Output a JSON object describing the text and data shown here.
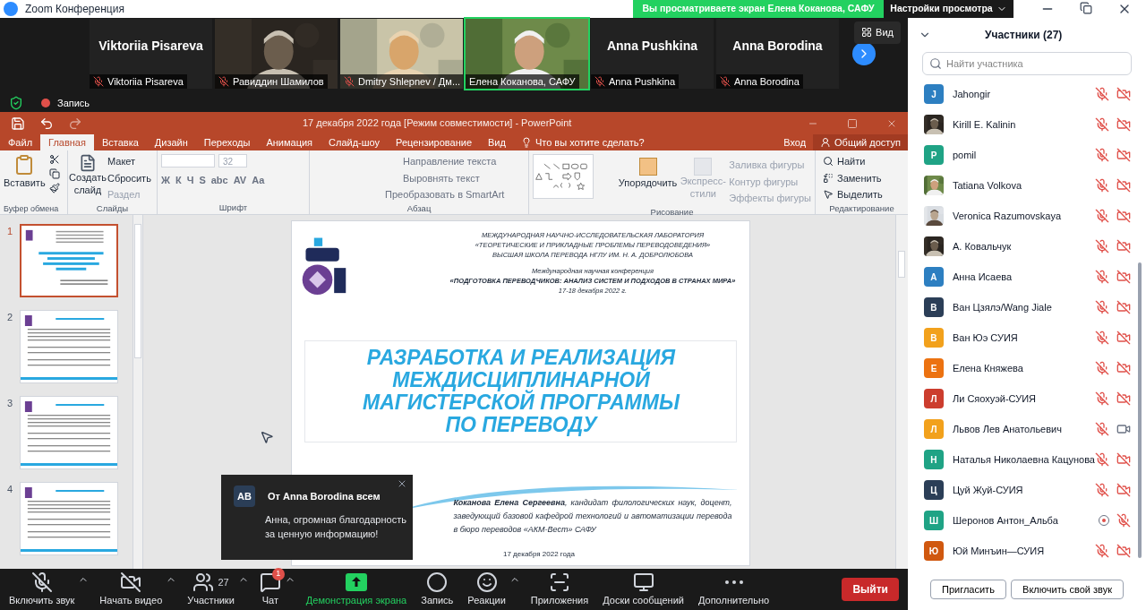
{
  "app_title": "Zoom Конференция",
  "share_banner": "Вы просматриваете экран Елена Коканова, САФУ",
  "view_settings": "Настройки просмотра",
  "view_button": "Вид",
  "recording_label": "Запись",
  "video_tiles": [
    {
      "name": "Viktoriia Pisareva",
      "display_name": "Viktoriia Pisareva",
      "kind": "name",
      "muted": true,
      "speaking": false
    },
    {
      "name": "Равиддин Шамилов",
      "kind": "video",
      "muted": true,
      "speaking": false
    },
    {
      "name": "Dmitry Shlepnev / Дм...",
      "kind": "video",
      "muted": true,
      "speaking": false
    },
    {
      "name": "Елена Коканова, САФУ",
      "kind": "video",
      "muted": false,
      "speaking": true
    },
    {
      "name": "Anna Pushkina",
      "display_name": "Anna Pushkina",
      "kind": "name",
      "muted": true,
      "speaking": false
    },
    {
      "name": "Anna Borodina",
      "display_name": "Anna Borodina",
      "kind": "name",
      "muted": true,
      "speaking": false
    }
  ],
  "ppt": {
    "title": "17 декабря 2022 года [Режим совместимости] - PowerPoint",
    "tabs": [
      {
        "label": "Файл",
        "selected": false
      },
      {
        "label": "Главная",
        "selected": true
      },
      {
        "label": "Вставка",
        "selected": false
      },
      {
        "label": "Дизайн",
        "selected": false
      },
      {
        "label": "Переходы",
        "selected": false
      },
      {
        "label": "Анимация",
        "selected": false
      },
      {
        "label": "Слайд-шоу",
        "selected": false
      },
      {
        "label": "Рецензирование",
        "selected": false
      },
      {
        "label": "Вид",
        "selected": false
      }
    ],
    "tell_me": "Что вы хотите сделать?",
    "sign_in": "Вход",
    "share": "Общий доступ",
    "ribbon": {
      "paste": "Вставить",
      "new_slide": "Создать слайд",
      "layout": "Макет",
      "reset": "Сбросить",
      "section": "Раздел",
      "font_size": "32",
      "font_buttons": [
        "Ж",
        "К",
        "Ч",
        "S",
        "abc",
        "AV",
        "Aa"
      ],
      "text_direction": "Направление текста",
      "align_text": "Выровнять текст",
      "smartart": "Преобразовать в SmartArt",
      "arrange": "Упорядочить",
      "quick_styles": "Экспресс-стили",
      "shape_fill": "Заливка фигуры",
      "shape_outline": "Контур фигуры",
      "shape_effects": "Эффекты фигуры",
      "find": "Найти",
      "replace": "Заменить",
      "select": "Выделить",
      "groups": [
        "Буфер обмена",
        "Слайды",
        "Шрифт",
        "Абзац",
        "Рисование",
        "Редактирование"
      ]
    },
    "thumbnails": [
      {
        "number": "1",
        "selected": true
      },
      {
        "number": "2",
        "selected": false
      },
      {
        "number": "3",
        "selected": false
      },
      {
        "number": "4",
        "selected": false
      }
    ],
    "slide": {
      "header": [
        "МЕЖДУНАРОДНАЯ НАУЧНО-ИССЛЕДОВАТЕЛЬСКАЯ ЛАБОРАТОРИЯ",
        "«ТЕОРЕТИЧЕСКИЕ И ПРИКЛАДНЫЕ ПРОБЛЕМЫ ПЕРЕВОДОВЕДЕНИЯ»",
        "ВЫСШАЯ ШКОЛА ПЕРЕВОДА НГЛУ ИМ. Н. А. ДОБРОЛЮБОВА"
      ],
      "conference": "Международная научная конференция",
      "conference_title": "«ПОДГОТОВКА ПЕРЕВОДЧИКОВ: АНАЛИЗ СИСТЕМ И ПОДХОДОВ В СТРАНАХ МИРА»",
      "dates": "17-18 декабря 2022 г.",
      "title": [
        "РАЗРАБОТКА И РЕАЛИЗАЦИЯ",
        "МЕЖДИСЦИПЛИНАРНОЙ",
        "МАГИСТЕРСКОЙ ПРОГРАММЫ",
        "ПО ПЕРЕВОДУ"
      ],
      "author": "**Коканова Елена Сергеевна**, кандидат филологических наук, доцент, заведующий базовой кафедрой технологий и автоматизации перевода в бюро переводов «АКМ-Вест» САФУ",
      "date": "17 декабря 2022 года"
    }
  },
  "chat_popup": {
    "initials": "AB",
    "sender": "От Anna Borodina всем",
    "message": "Анна, огромная благодарность за ценную информацию!"
  },
  "toolbar": [
    {
      "kind": "mic-off",
      "label": "Включить звук",
      "caret": true
    },
    {
      "kind": "video-off",
      "label": "Начать видео",
      "caret": true
    },
    {
      "kind": "people",
      "label": "Участники",
      "count": "27",
      "caret": true
    },
    {
      "kind": "chat",
      "label": "Чат",
      "badge": "1",
      "caret": true
    },
    {
      "kind": "share",
      "label": "Демонстрация экрана",
      "caret": false
    },
    {
      "kind": "record",
      "label": "Запись",
      "caret": false
    },
    {
      "kind": "reactions",
      "label": "Реакции",
      "caret": true
    },
    {
      "kind": "apps",
      "label": "Приложения",
      "caret": false
    },
    {
      "kind": "whiteboard",
      "label": "Доски сообщений",
      "caret": false
    },
    {
      "kind": "more",
      "label": "Дополнительно",
      "caret": false
    }
  ],
  "leave": "Выйти",
  "participants": {
    "title": "Участники (27)",
    "search_placeholder": "Найти участника",
    "list": [
      {
        "name": "Jahongir",
        "initial": "J",
        "color": "#2d7fc1",
        "recording": false,
        "muted": true,
        "video_on": false
      },
      {
        "name": "Kirill E. Kalinin",
        "kind": "picture",
        "recording": false,
        "muted": true,
        "video_on": false
      },
      {
        "name": "pomil",
        "initial": "P",
        "color": "#1fa385",
        "recording": false,
        "muted": true,
        "video_on": false
      },
      {
        "name": "Tatiana Volkova",
        "kind": "picture",
        "recording": false,
        "muted": true,
        "video_on": false
      },
      {
        "name": "Veronica Razumovskaya",
        "kind": "picture",
        "recording": false,
        "muted": true,
        "video_on": false
      },
      {
        "name": "А. Ковальчук",
        "kind": "picture",
        "recording": false,
        "muted": true,
        "video_on": false
      },
      {
        "name": "Анна Исаева",
        "initial": "А",
        "color": "#2d7fc1",
        "recording": false,
        "muted": true,
        "video_on": false
      },
      {
        "name": "Ван Цзялэ/Wang Jiale",
        "initial": "В",
        "color": "#2b3e57",
        "recording": false,
        "muted": true,
        "video_on": false
      },
      {
        "name": "Ван Юэ СУИЯ",
        "initial": "В",
        "color": "#f2a11c",
        "recording": false,
        "muted": true,
        "video_on": false
      },
      {
        "name": "Елена Княжева",
        "initial": "Е",
        "color": "#ec7211",
        "recording": false,
        "muted": true,
        "video_on": false
      },
      {
        "name": "Ли Сяохуэй-СУИЯ",
        "initial": "Л",
        "color": "#cc3d2e",
        "recording": false,
        "muted": true,
        "video_on": false
      },
      {
        "name": "Львов Лев Анатольевич",
        "initial": "Л",
        "color": "#f2a11c",
        "recording": false,
        "muted": true,
        "video_on": true
      },
      {
        "name": "Наталья Николаевна Кацунова",
        "initial": "Н",
        "color": "#1fa385",
        "recording": false,
        "muted": true,
        "video_on": false
      },
      {
        "name": "Цуй Жуй-СУИЯ",
        "initial": "Ц",
        "color": "#2b3e57",
        "recording": false,
        "muted": true,
        "video_on": false
      },
      {
        "name": "Шеронов Антон_Альба",
        "initial": "Ш",
        "color": "#1fa385",
        "recording": true,
        "muted": true
      },
      {
        "name": "Юй Минъин—СУИЯ",
        "initial": "Ю",
        "color": "#d0580f",
        "recording": false,
        "muted": true,
        "video_on": false
      }
    ],
    "invite": "Пригласить",
    "unmute_self": "Включить свой звук"
  }
}
